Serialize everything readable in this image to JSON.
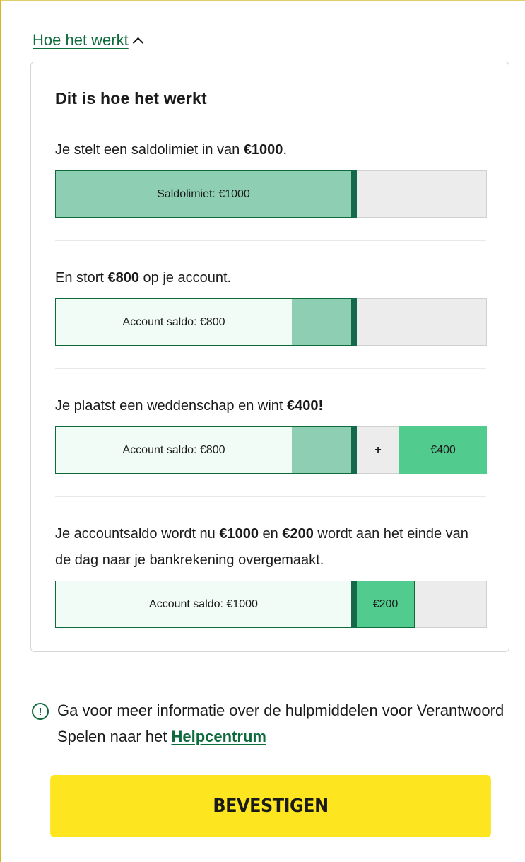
{
  "toggle": {
    "label": "Hoe het werkt"
  },
  "card": {
    "title": "Dit is hoe het werkt",
    "steps": [
      {
        "text_parts": [
          "Je stelt een saldolimiet in van ",
          "€1000",
          "."
        ],
        "bar": {
          "limit_label": "Saldolimiet: €1000"
        }
      },
      {
        "text_parts": [
          "En stort ",
          "€800",
          " op je account."
        ],
        "bar": {
          "balance_label": "Account saldo: €800"
        }
      },
      {
        "text_parts": [
          "Je plaatst een weddenschap en wint ",
          "€400!"
        ],
        "bar": {
          "balance_label": "Account saldo: €800",
          "plus": "+",
          "win_label": "€400"
        }
      },
      {
        "text_parts": [
          "Je accountsaldo wordt nu ",
          "€1000",
          " en ",
          "€200",
          " wordt aan het einde van de dag naar je bankrekening overgemaakt."
        ],
        "bar": {
          "balance_label": "Account saldo: €1000",
          "transfer_label": "€200"
        }
      }
    ]
  },
  "info": {
    "text": "Ga voor meer informatie over de hulpmiddelen voor Verantwoord Spelen naar het",
    "link": "Helpcentrum"
  },
  "confirm_label": "BEVESTIGEN",
  "colors": {
    "brand_green": "#0e6b3c",
    "limit_fill": "#8ecfb4",
    "balance_fill": "#f1fcf6",
    "win_fill": "#52cc8e",
    "empty_fill": "#ececec",
    "confirm_bg": "#fde51f"
  }
}
